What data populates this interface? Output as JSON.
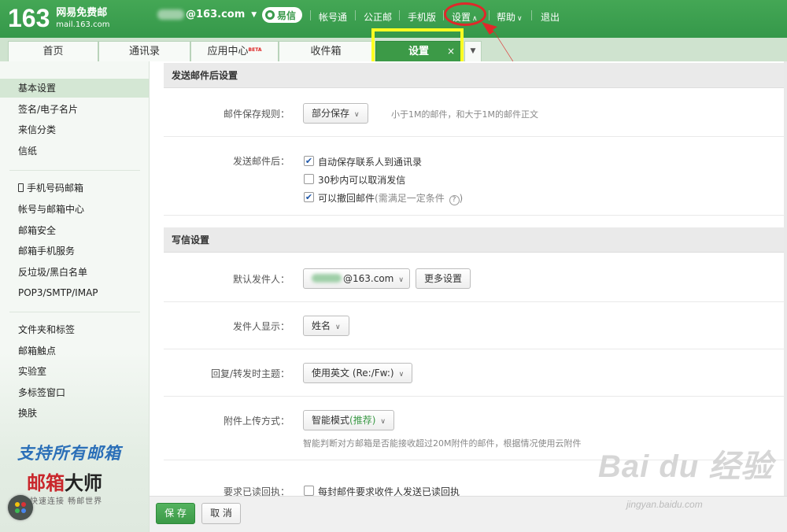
{
  "header": {
    "logo_number": "163",
    "logo_title": "网易免费邮",
    "logo_domain": "mail.163.com",
    "account": "@163.com",
    "yixin": "易信",
    "nav": [
      "帐号通",
      "公正邮",
      "手机版"
    ],
    "settings": "设置",
    "help": "帮助",
    "logout": "退出"
  },
  "tabs": {
    "items": [
      "首页",
      "通讯录",
      "应用中心",
      "收件箱"
    ],
    "beta": "BETA",
    "active": "设置",
    "close": "×"
  },
  "sidebar": {
    "group1": [
      "基本设置",
      "签名/电子名片",
      "来信分类",
      "信纸"
    ],
    "group2": [
      "手机号码邮箱",
      "帐号与邮箱中心",
      "邮箱安全",
      "邮箱手机服务",
      "反垃圾/黑白名单",
      "POP3/SMTP/IMAP"
    ],
    "group3": [
      "文件夹和标签",
      "邮箱触点",
      "实验室",
      "多标签窗口",
      "换肤"
    ],
    "promo_line1": "支持所有邮箱",
    "promo_line2a": "邮箱",
    "promo_line2b": "大师",
    "promo_line3": "快速连接 畅邮世界"
  },
  "section_send": {
    "title": "发送邮件后设置",
    "save_rule_label": "邮件保存规则：",
    "save_rule_value": "部分保存",
    "save_rule_hint": "小于1M的邮件，和大于1M的邮件正文",
    "after_send_label": "发送邮件后：",
    "options": [
      {
        "text": "自动保存联系人到通讯录",
        "checked": true
      },
      {
        "text": "30秒内可以取消发信",
        "checked": false
      },
      {
        "text": "可以撤回邮件",
        "note": "(需满足一定条件",
        "checked": true
      }
    ],
    "note_close": ")"
  },
  "section_write": {
    "title": "写信设置",
    "sender_label": "默认发件人：",
    "sender_value": "@163.com",
    "more_settings": "更多设置",
    "display_label": "发件人显示：",
    "display_value": "姓名",
    "reply_label": "回复/转发时主题：",
    "reply_value": "使用英文 (Re:/Fw:)",
    "attach_label": "附件上传方式：",
    "attach_value": "智能模式",
    "attach_recommend": "(推荐)",
    "attach_hint": "智能判断对方邮箱是否能接收超过20M附件的邮件，根据情况使用云附件",
    "receipt_label": "要求已读回执：",
    "receipt_option": "每封邮件要求收件人发送已读回执"
  },
  "buttons": {
    "save": "保 存",
    "cancel": "取 消"
  },
  "watermark": {
    "brand": "Bai du 经验",
    "url": "jingyan.baidu.com"
  },
  "colors": {
    "brand_green": "#3c9a47",
    "highlight_yellow": "#ffff22",
    "annotation_red": "#e0282a"
  }
}
